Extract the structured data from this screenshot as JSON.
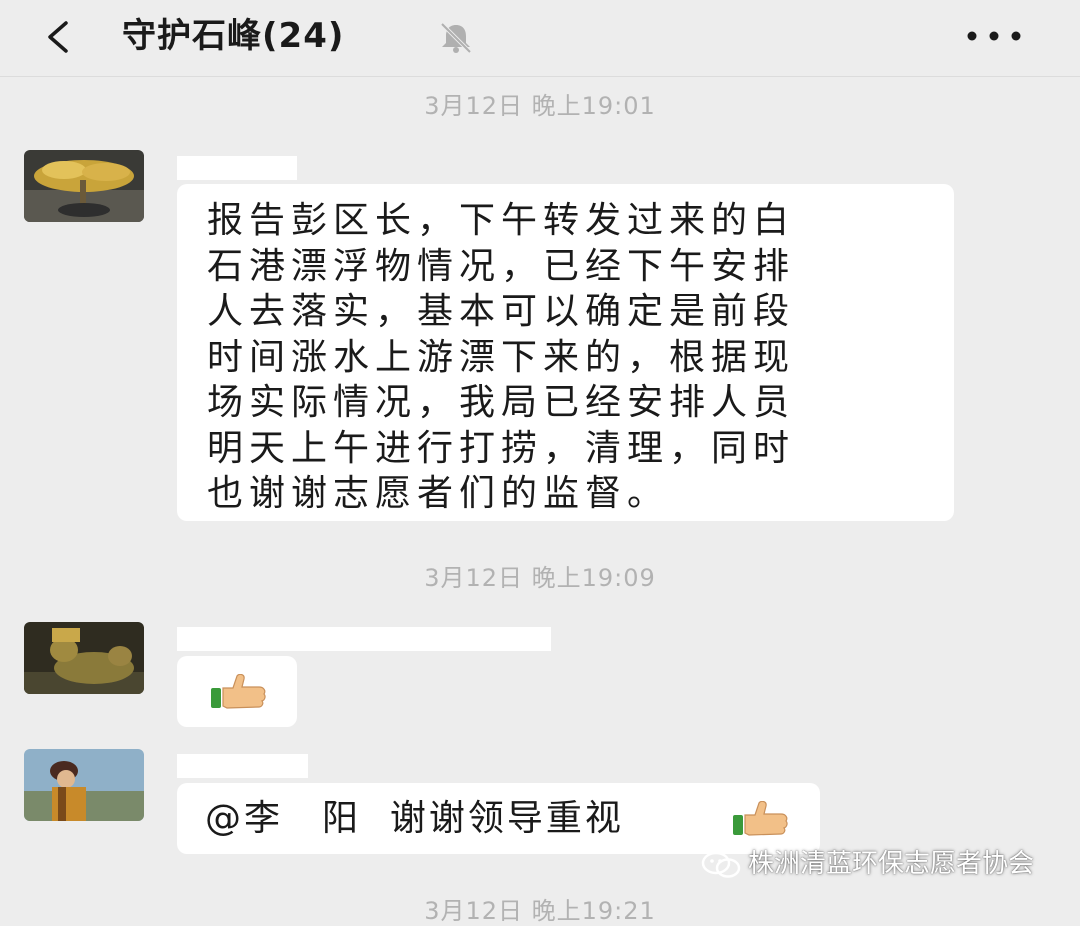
{
  "header": {
    "title": "守护石峰(24)",
    "back_icon": "chevron-left-icon",
    "mute_icon": "bell-muted-icon",
    "more_icon": "more-dots-icon"
  },
  "messages": [
    {
      "timestamp": "3月12日 晚上19:01",
      "lines": [
        "报告彭区长，下午转发过来的白",
        "石港漂浮物情况，已经下午安排",
        "人去落实，基本可以确定是前段",
        "时间涨水上游漂下来的，根据现",
        "场实际情况，我局已经安排人员",
        "明天上午进行打捞，清理，同时",
        "也谢谢志愿者们的监督。"
      ]
    },
    {
      "timestamp": "3月12日 晚上19:09",
      "emoji": "thumbs-up-icon"
    },
    {
      "text": "@李　阳  谢谢领导重视",
      "emoji": "thumbs-up-icon"
    },
    {
      "timestamp": "3月12日 晚上19:21"
    }
  ],
  "watermark": {
    "text": "株洲清蓝环保志愿者协会",
    "icon": "wechat-official-account-icon"
  },
  "colors": {
    "background": "#ededed",
    "bubble": "#ffffff",
    "timestamp": "#b2b2b2"
  }
}
